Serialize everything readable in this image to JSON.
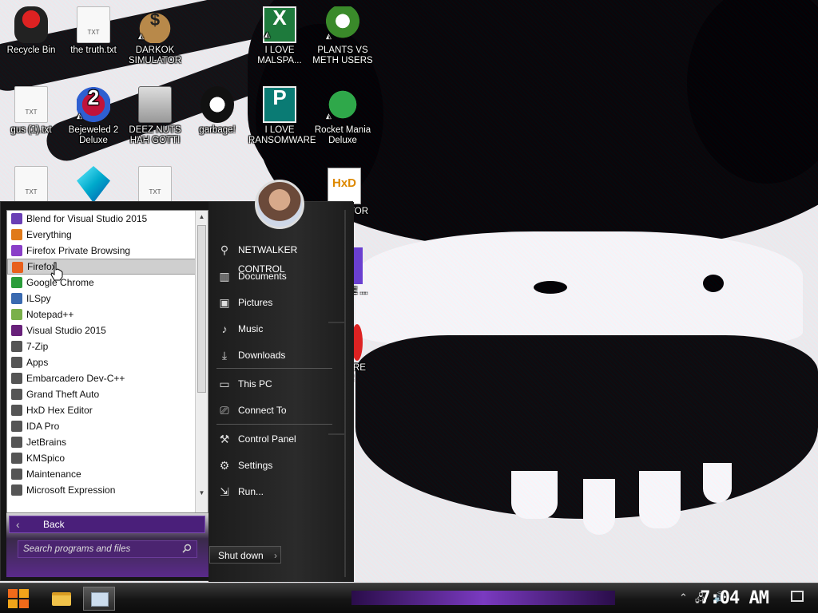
{
  "desktop": {
    "icons": [
      {
        "label": "Recycle Bin",
        "icon": "recycle-bin-icon"
      },
      {
        "label": "the truth.txt",
        "icon": "text-file-icon"
      },
      {
        "label": "DARKOK SIMULATOR",
        "icon": "money-sack-icon"
      },
      {
        "label": "I LOVE MALSPA...",
        "icon": "excel-icon"
      },
      {
        "label": "PLANTS VS METH USERS",
        "icon": "plants-vs-zombies-icon"
      },
      {
        "label": "gus (1).txt",
        "icon": "text-file-icon"
      },
      {
        "label": "Bejeweled 2 Deluxe",
        "icon": "bejeweled-icon"
      },
      {
        "label": "DEEZ NUTS HAH GOTTI",
        "icon": "windows-stack-icon"
      },
      {
        "label": "garbage!",
        "icon": "garbage-app-icon"
      },
      {
        "label": "I LOVE RANSOMWARE",
        "icon": "publisher-icon"
      },
      {
        "label": "Rocket Mania Deluxe",
        "icon": "rocket-mania-icon"
      },
      {
        "label": "TOR",
        "icon": "hxd-icon"
      },
      {
        "label": "E ...",
        "icon": "app-icon"
      },
      {
        "label": "RE TOR",
        "icon": "app-icon"
      }
    ]
  },
  "start_menu": {
    "programs": [
      {
        "label": "Blend for Visual Studio 2015",
        "color": "#6a3fb5"
      },
      {
        "label": "Everything",
        "color": "#e07a1a"
      },
      {
        "label": "Firefox Private Browsing",
        "color": "#8a3fc8"
      },
      {
        "label": "Firefox",
        "color": "#e8601c"
      },
      {
        "label": "Google Chrome",
        "color": "#2a9d3a"
      },
      {
        "label": "ILSpy",
        "color": "#3a6ab0"
      },
      {
        "label": "Notepad++",
        "color": "#7ab04a"
      },
      {
        "label": "Visual Studio 2015",
        "color": "#68217a"
      },
      {
        "label": "7-Zip",
        "color": "#555555"
      },
      {
        "label": "Apps",
        "color": "#555555"
      },
      {
        "label": "Embarcadero Dev-C++",
        "color": "#555555"
      },
      {
        "label": "Grand Theft Auto",
        "color": "#555555"
      },
      {
        "label": "HxD Hex Editor",
        "color": "#555555"
      },
      {
        "label": "IDA Pro",
        "color": "#555555"
      },
      {
        "label": "JetBrains",
        "color": "#555555"
      },
      {
        "label": "KMSpico",
        "color": "#555555"
      },
      {
        "label": "Maintenance",
        "color": "#555555"
      },
      {
        "label": "Microsoft Expression",
        "color": "#555555"
      }
    ],
    "hovered_index": 3,
    "back_label": "Back",
    "search_placeholder": "Search programs and files",
    "right_items": [
      {
        "label": "NETWALKER CONTROL",
        "icon": "user-folder-icon"
      },
      {
        "label": "Documents",
        "icon": "library-icon"
      },
      {
        "label": "Pictures",
        "icon": "pictures-icon"
      },
      {
        "label": "Music",
        "icon": "music-icon"
      },
      {
        "label": "Downloads",
        "icon": "download-icon"
      },
      {
        "label": "This PC",
        "icon": "computer-icon"
      },
      {
        "label": "Connect To",
        "icon": "connect-icon"
      },
      {
        "label": "Control Panel",
        "icon": "wrench-icon"
      },
      {
        "label": "Settings",
        "icon": "gear-icon"
      },
      {
        "label": "Run...",
        "icon": "run-icon"
      }
    ],
    "shutdown_label": "Shut down"
  },
  "taskbar": {
    "clock": "7:04 AM",
    "accent": "#7a3ac0"
  }
}
